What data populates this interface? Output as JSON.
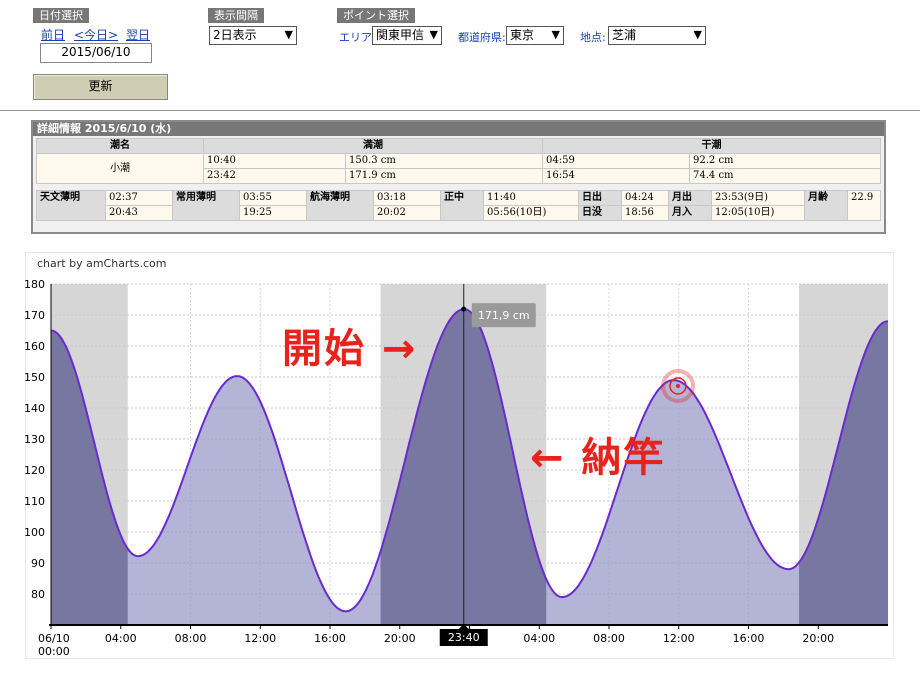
{
  "date_select": {
    "label": "日付選択",
    "prev": "前日",
    "today": "<今日>",
    "next": "翌日",
    "date": "2015/06/10",
    "update_button": "更新"
  },
  "interval_select": {
    "label": "表示間隔",
    "value": "2日表示"
  },
  "point_select": {
    "label": "ポイント選択",
    "area_label": "エリア:",
    "area_value": "関東甲信",
    "pref_label": "都道府県:",
    "pref_value": "東京",
    "place_label": "地点:",
    "place_value": "芝浦"
  },
  "detail": {
    "title": "詳細情報  2015/6/10 (水)",
    "headers": [
      "潮名",
      "満潮",
      "干潮"
    ],
    "tide_name": "小潮",
    "high": [
      {
        "time": "10:40",
        "level": "150.3 cm"
      },
      {
        "time": "23:42",
        "level": "171.9 cm"
      }
    ],
    "low": [
      {
        "time": "04:59",
        "level": "92.2 cm"
      },
      {
        "time": "16:54",
        "level": "74.4 cm"
      }
    ],
    "astro": {
      "label": "天文薄明",
      "v1": "02:37",
      "v2": "20:43",
      "civil_label": "常用薄明",
      "c1": "03:55",
      "c2": "19:25",
      "naut_label": "航海薄明",
      "n1": "03:18",
      "n2": "20:02",
      "noon_label": "正中",
      "noon1": "11:40",
      "noon2": "05:56(10日)",
      "sunrise_label": "日出",
      "sunrise": "04:24",
      "sunset_label": "日没",
      "sunset": "18:56",
      "moonrise_label": "月出",
      "moonrise": "23:53(9日)",
      "moonset_label": "月入",
      "moonset": "12:05(10日)",
      "moonage_label": "月齢",
      "moonage": "22.9"
    }
  },
  "chart_credit": "chart by amCharts.com",
  "annotations": {
    "start": "開始 →",
    "end": "← 納竿"
  },
  "colors": {
    "line": "#6a2ad0",
    "fill": "#9b9bc8",
    "dark_fill": "#6f6f9a",
    "night": "#d6d6d6",
    "cursor_label_bg": "#000000",
    "annotation": "#e8221c"
  },
  "chart_data": {
    "type": "area",
    "title": "",
    "xlabel": "",
    "ylabel": "",
    "ylim": [
      70,
      180
    ],
    "yticks": [
      80,
      90,
      100,
      110,
      120,
      130,
      140,
      150,
      160,
      170,
      180
    ],
    "x_tick_labels": [
      "06/10 00:00",
      "04:00",
      "08:00",
      "12:00",
      "16:00",
      "20:00",
      "00:00",
      "04:00",
      "08:00",
      "12:00",
      "16:00",
      "20:00"
    ],
    "x_tick_hours": [
      0,
      4,
      8,
      12,
      16,
      20,
      24,
      28,
      32,
      36,
      40,
      44
    ],
    "x_range_hours": [
      0,
      48
    ],
    "series": [
      {
        "x_hours": [
          0,
          4.98,
          10.67,
          16.9,
          23.7,
          29.3,
          35.7,
          42.3,
          48
        ],
        "y": [
          165,
          92.2,
          150.3,
          74.4,
          171.9,
          79,
          149,
          88,
          168
        ]
      }
    ],
    "night_bands_hours": [
      [
        0,
        4.4
      ],
      [
        18.9,
        28.4
      ],
      [
        42.9,
        48
      ]
    ],
    "cursor": {
      "x_hours": 23.67,
      "y": 171.9,
      "label": "171,9 cm",
      "time_label": "23:40"
    }
  }
}
